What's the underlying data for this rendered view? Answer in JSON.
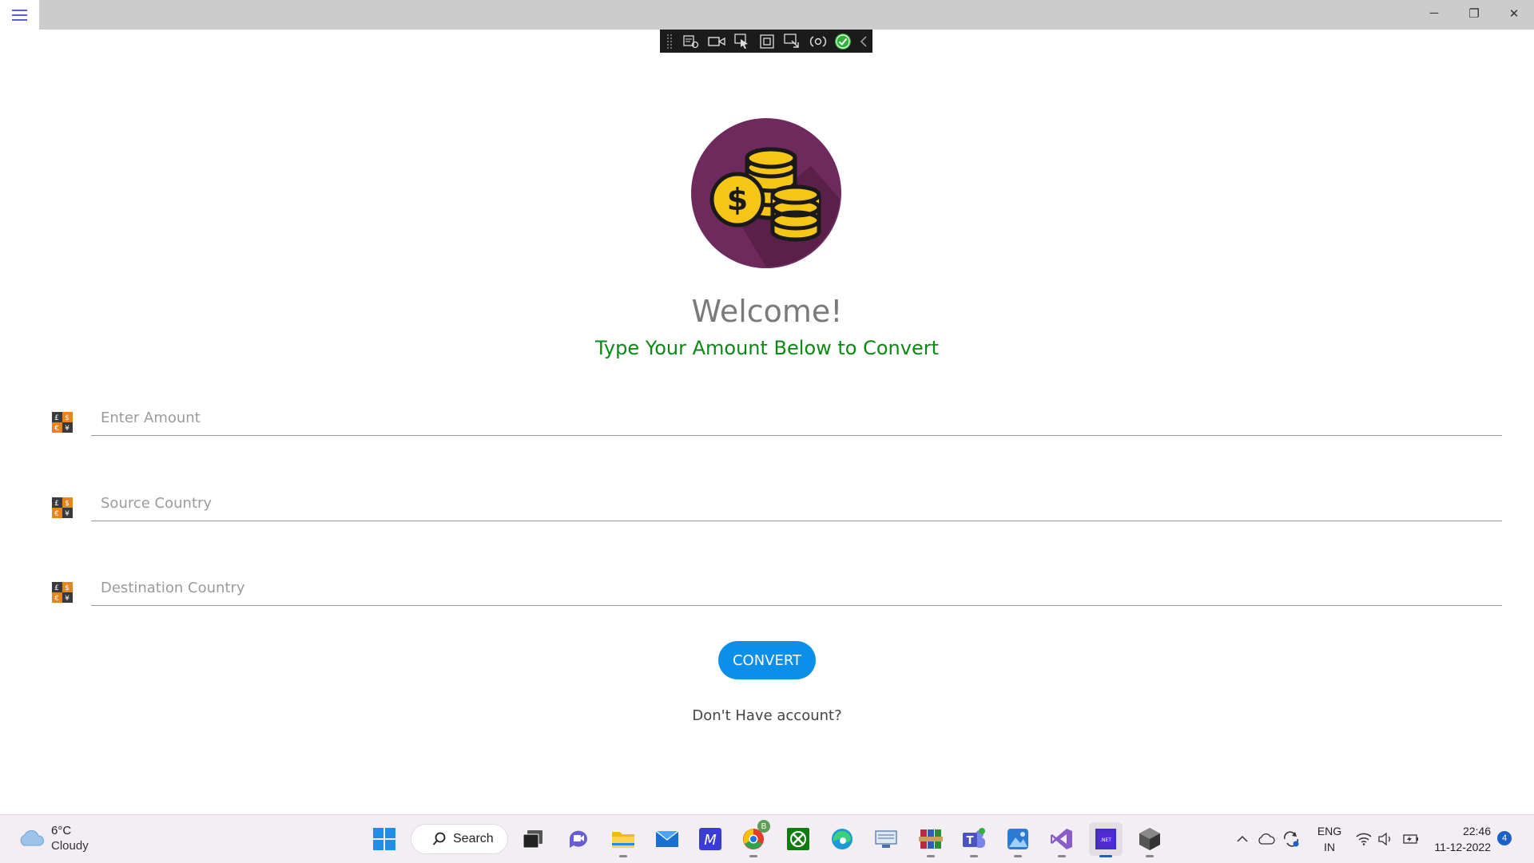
{
  "titlebar": {
    "menu_icon": "hamburger-icon",
    "minimize_glyph": "─",
    "maximize_glyph": "❐",
    "close_glyph": "✕"
  },
  "debug_toolbar": {
    "tools": [
      "live-visual-tree-icon",
      "record-icon",
      "select-element-icon",
      "display-layout-adorners-icon",
      "track-focus-icon",
      "hot-reload-icon",
      "status-ok-icon",
      "collapse-icon"
    ]
  },
  "main": {
    "welcome": "Welcome!",
    "subtitle": "Type Your Amount Below to Convert",
    "fields": [
      {
        "placeholder": "Enter Amount",
        "icon": "exchange-icon"
      },
      {
        "placeholder": "Source Country",
        "icon": "exchange-icon"
      },
      {
        "placeholder": "Destination Country",
        "icon": "exchange-icon"
      }
    ],
    "convert_label": "CONVERT",
    "no_account": "Don't Have account?"
  },
  "taskbar": {
    "weather_temp": "6°C",
    "weather_desc": "Cloudy",
    "search_label": "Search",
    "chrome_badge": "B",
    "lang_line1": "ENG",
    "lang_line2": "IN",
    "time": "22:46",
    "date": "11-12-2022",
    "notification_count": "4"
  },
  "colors": {
    "accent": "#0b8fe8",
    "subtitle_green": "#0a8a14",
    "logo_purple": "#6e2a5c",
    "coin_gold": "#f5c518"
  }
}
